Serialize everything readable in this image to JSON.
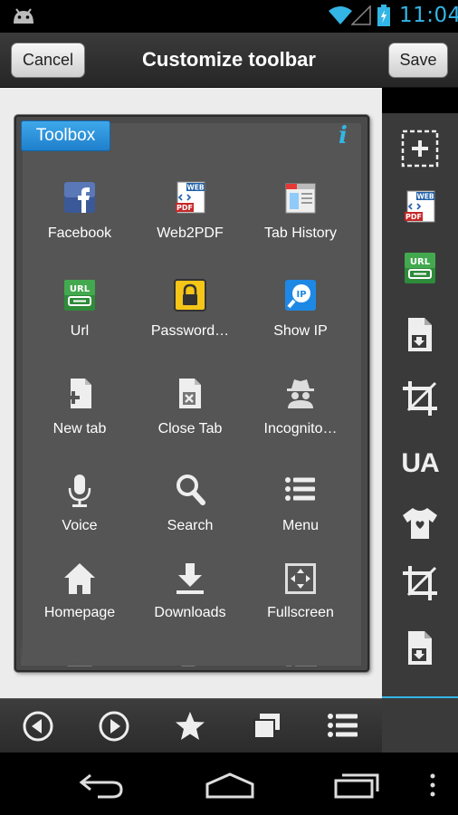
{
  "status_bar": {
    "time": "11:04"
  },
  "title_bar": {
    "cancel_label": "Cancel",
    "title": "Customize toolbar",
    "save_label": "Save"
  },
  "toolbox": {
    "tag": "Toolbox",
    "info_symbol": "i",
    "items": [
      {
        "label": "Facebook",
        "icon": "facebook-icon"
      },
      {
        "label": "Web2PDF",
        "icon": "web2pdf-icon"
      },
      {
        "label": "Tab History",
        "icon": "tab-history-icon"
      },
      {
        "label": "Url",
        "icon": "url-icon"
      },
      {
        "label": "Password…",
        "icon": "lock-icon"
      },
      {
        "label": "Show IP",
        "icon": "show-ip-icon"
      },
      {
        "label": "New tab",
        "icon": "new-tab-icon"
      },
      {
        "label": "Close Tab",
        "icon": "close-tab-icon"
      },
      {
        "label": "Incognito…",
        "icon": "incognito-icon"
      },
      {
        "label": "Voice",
        "icon": "microphone-icon"
      },
      {
        "label": "Search",
        "icon": "search-icon"
      },
      {
        "label": "Menu",
        "icon": "menu-icon"
      },
      {
        "label": "Homepage",
        "icon": "home-icon"
      },
      {
        "label": "Downloads",
        "icon": "download-icon"
      },
      {
        "label": "Fullscreen",
        "icon": "fullscreen-icon"
      }
    ]
  },
  "right_strip": {
    "ua_label": "UA",
    "items": [
      "add-slot-icon",
      "web2pdf-icon",
      "url-icon",
      "save-page-icon",
      "crop-icon",
      "ua-icon",
      "theme-icon",
      "crop-icon",
      "save-page-icon"
    ]
  },
  "bottom_toolbar": [
    "back-icon",
    "forward-icon",
    "bookmark-star-icon",
    "tabs-icon",
    "menu-icon"
  ],
  "colors": {
    "accent": "#33b5e5",
    "toolbox_tag": "#2b8fdb",
    "panel": "#4a4a4a"
  },
  "badges": {
    "url_text": "URL",
    "web_text": "WEB",
    "pdf_text": "PDF",
    "ip_text": "IP"
  }
}
